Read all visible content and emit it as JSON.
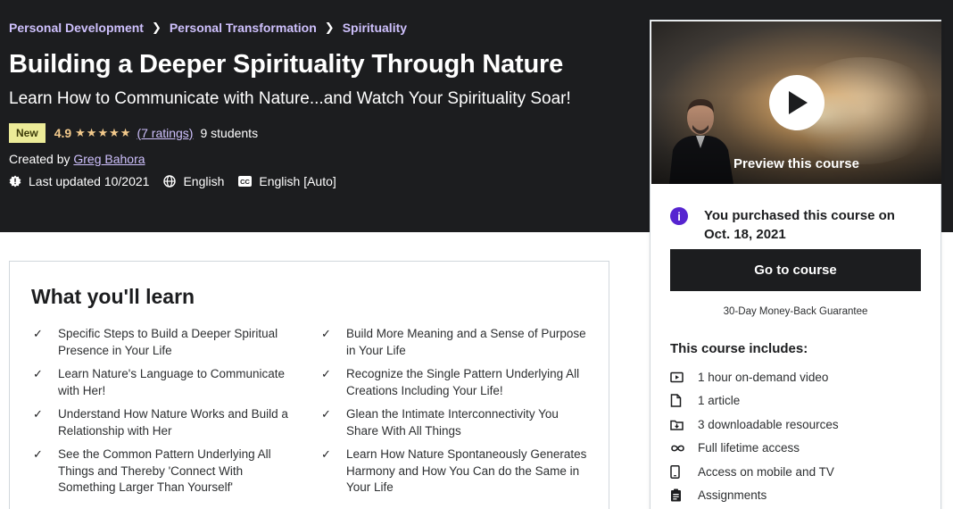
{
  "breadcrumb": [
    "Personal Development",
    "Personal Transformation",
    "Spirituality"
  ],
  "course": {
    "title": "Building a Deeper Spirituality Through Nature",
    "subtitle": "Learn How to Communicate with Nature...and Watch Your Spirituality Soar!",
    "badge": "New",
    "rating": "4.9",
    "stars": "★★★★★",
    "ratings_link": "(7 ratings)",
    "students": "9 students",
    "created_prefix": "Created by",
    "instructor": "Greg Bahora",
    "last_updated": "Last updated 10/2021",
    "language": "English",
    "captions": "English [Auto]"
  },
  "learn": {
    "title": "What you'll learn",
    "check_glyph": "✓",
    "left": [
      "Specific Steps to Build a Deeper Spiritual Presence in Your Life",
      "Learn Nature's Language to Communicate with Her!",
      "Understand How Nature Works and Build a Relationship with Her",
      "See the Common Pattern Underlying All Things and Thereby 'Connect With Something Larger Than Yourself'"
    ],
    "right": [
      "Build More Meaning and a Sense of Purpose in Your Life",
      "Recognize the Single Pattern Underlying All Creations Including Your Life!",
      "Glean the Intimate Interconnectivity You Share With All Things",
      "Learn How Nature Spontaneously Generates Harmony and How You Can do the Same in Your Life"
    ]
  },
  "sidebar": {
    "preview_label": "Preview this course",
    "info_glyph": "i",
    "purchased_text": "You purchased this course on Oct. 18, 2021",
    "go_button": "Go to course",
    "guarantee": "30-Day Money-Back Guarantee",
    "includes_title": "This course includes:",
    "includes": [
      {
        "icon": "video-icon",
        "label": "1 hour on-demand video"
      },
      {
        "icon": "article-icon",
        "label": "1 article"
      },
      {
        "icon": "download-icon",
        "label": "3 downloadable resources"
      },
      {
        "icon": "infinity-icon",
        "label": "Full lifetime access"
      },
      {
        "icon": "mobile-icon",
        "label": "Access on mobile and TV"
      },
      {
        "icon": "assignment-icon",
        "label": "Assignments"
      }
    ]
  },
  "colors": {
    "hero_bg": "#1c1d1f",
    "link_purple": "#cec0fc",
    "star_gold": "#f3ca8c",
    "badge_bg": "#eceb98",
    "info_purple": "#5624d0"
  }
}
